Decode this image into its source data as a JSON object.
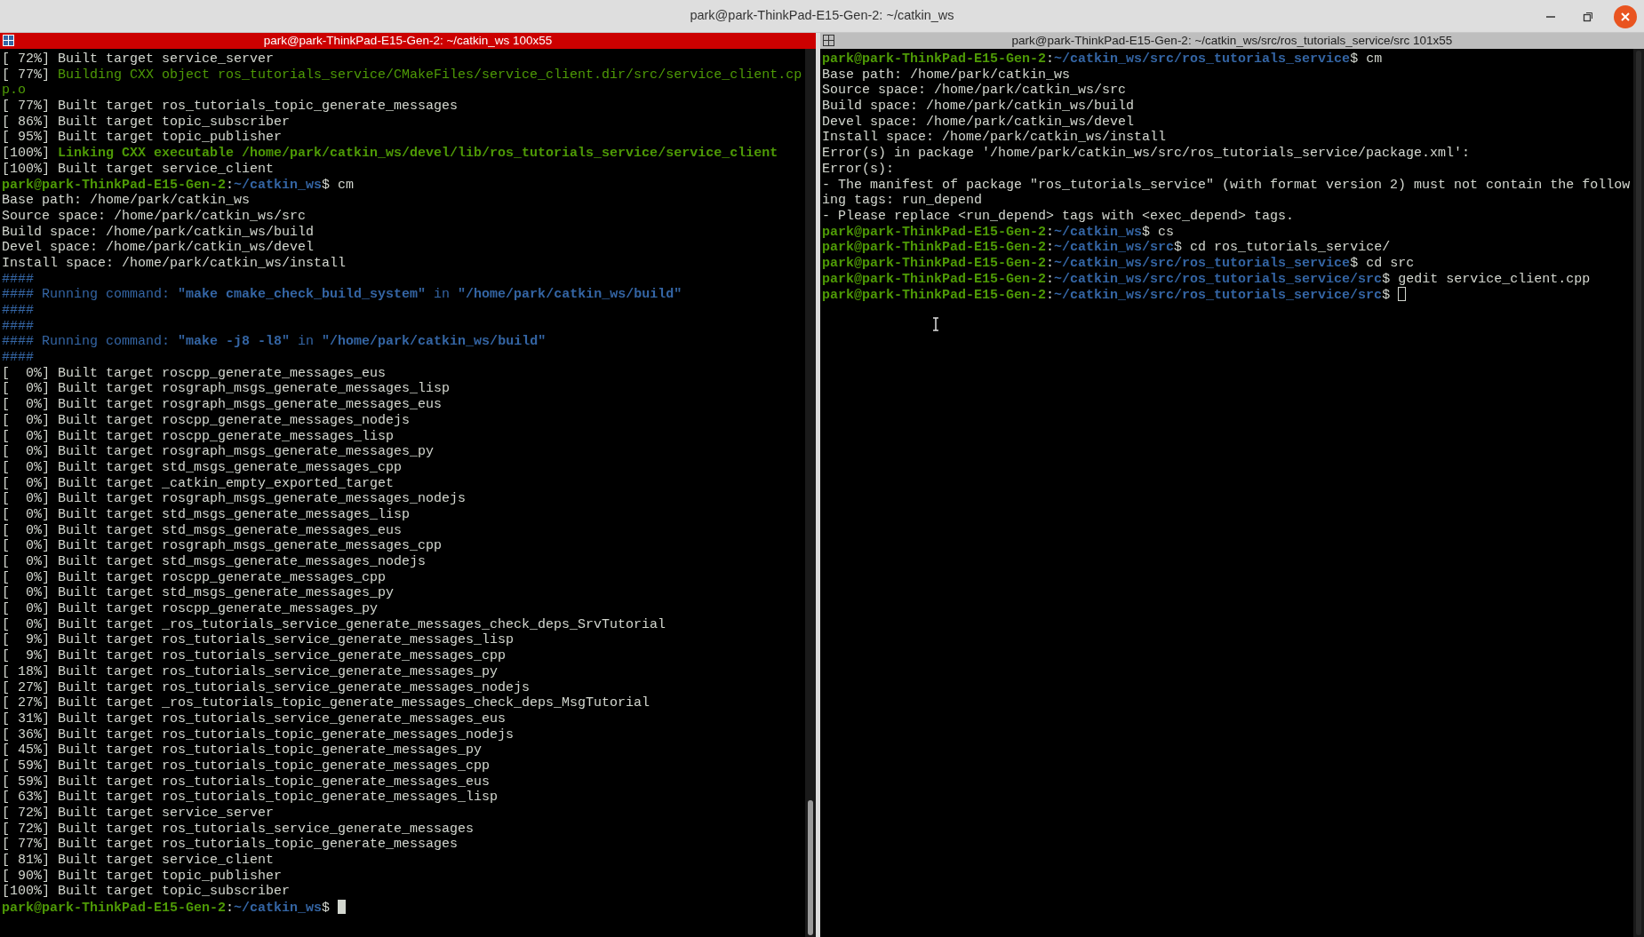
{
  "window": {
    "title": "park@park-ThinkPad-E15-Gen-2: ~/catkin_ws"
  },
  "panes": [
    {
      "title": "park@park-ThinkPad-E15-Gen-2: ~/catkin_ws 100x55",
      "focused": true,
      "lines": [
        [
          {
            "kind": "plain",
            "text": "[ 72%] Built target service_server"
          }
        ],
        [
          {
            "kind": "plain",
            "text": "[ 77%] "
          },
          {
            "kind": "green",
            "text": "Building CXX object ros_tutorials_service/CMakeFiles/service_client.dir/src/service_client.cp"
          }
        ],
        [
          {
            "kind": "green",
            "text": "p.o"
          }
        ],
        [
          {
            "kind": "plain",
            "text": "[ 77%] Built target ros_tutorials_topic_generate_messages"
          }
        ],
        [
          {
            "kind": "plain",
            "text": "[ 86%] Built target topic_subscriber"
          }
        ],
        [
          {
            "kind": "plain",
            "text": "[ 95%] Built target topic_publisher"
          }
        ],
        [
          {
            "kind": "plain",
            "text": "[100%] "
          },
          {
            "kind": "green-bold",
            "text": "Linking CXX executable /home/park/catkin_ws/devel/lib/ros_tutorials_service/service_client"
          }
        ],
        [
          {
            "kind": "plain",
            "text": "[100%] Built target service_client"
          }
        ],
        [
          {
            "kind": "green-bold",
            "text": "park@park-ThinkPad-E15-Gen-2"
          },
          {
            "kind": "plain",
            "text": ":"
          },
          {
            "kind": "blue-bold",
            "text": "~/catkin_ws"
          },
          {
            "kind": "plain",
            "text": "$ cm"
          }
        ],
        [
          {
            "kind": "plain",
            "text": "Base path: /home/park/catkin_ws"
          }
        ],
        [
          {
            "kind": "plain",
            "text": "Source space: /home/park/catkin_ws/src"
          }
        ],
        [
          {
            "kind": "plain",
            "text": "Build space: /home/park/catkin_ws/build"
          }
        ],
        [
          {
            "kind": "plain",
            "text": "Devel space: /home/park/catkin_ws/devel"
          }
        ],
        [
          {
            "kind": "plain",
            "text": "Install space: /home/park/catkin_ws/install"
          }
        ],
        [
          {
            "kind": "blue",
            "text": "####"
          }
        ],
        [
          {
            "kind": "blue",
            "text": "#### Running command: "
          },
          {
            "kind": "blue-bold",
            "text": "\"make cmake_check_build_system\""
          },
          {
            "kind": "blue",
            "text": " in "
          },
          {
            "kind": "blue-bold",
            "text": "\"/home/park/catkin_ws/build\""
          }
        ],
        [
          {
            "kind": "blue",
            "text": "####"
          }
        ],
        [
          {
            "kind": "blue",
            "text": "####"
          }
        ],
        [
          {
            "kind": "blue",
            "text": "#### Running command: "
          },
          {
            "kind": "blue-bold",
            "text": "\"make -j8 -l8\""
          },
          {
            "kind": "blue",
            "text": " in "
          },
          {
            "kind": "blue-bold",
            "text": "\"/home/park/catkin_ws/build\""
          }
        ],
        [
          {
            "kind": "blue",
            "text": "####"
          }
        ],
        [
          {
            "kind": "plain",
            "text": "[  0%] Built target roscpp_generate_messages_eus"
          }
        ],
        [
          {
            "kind": "plain",
            "text": "[  0%] Built target rosgraph_msgs_generate_messages_lisp"
          }
        ],
        [
          {
            "kind": "plain",
            "text": "[  0%] Built target rosgraph_msgs_generate_messages_eus"
          }
        ],
        [
          {
            "kind": "plain",
            "text": "[  0%] Built target roscpp_generate_messages_nodejs"
          }
        ],
        [
          {
            "kind": "plain",
            "text": "[  0%] Built target roscpp_generate_messages_lisp"
          }
        ],
        [
          {
            "kind": "plain",
            "text": "[  0%] Built target rosgraph_msgs_generate_messages_py"
          }
        ],
        [
          {
            "kind": "plain",
            "text": "[  0%] Built target std_msgs_generate_messages_cpp"
          }
        ],
        [
          {
            "kind": "plain",
            "text": "[  0%] Built target _catkin_empty_exported_target"
          }
        ],
        [
          {
            "kind": "plain",
            "text": "[  0%] Built target rosgraph_msgs_generate_messages_nodejs"
          }
        ],
        [
          {
            "kind": "plain",
            "text": "[  0%] Built target std_msgs_generate_messages_lisp"
          }
        ],
        [
          {
            "kind": "plain",
            "text": "[  0%] Built target std_msgs_generate_messages_eus"
          }
        ],
        [
          {
            "kind": "plain",
            "text": "[  0%] Built target rosgraph_msgs_generate_messages_cpp"
          }
        ],
        [
          {
            "kind": "plain",
            "text": "[  0%] Built target std_msgs_generate_messages_nodejs"
          }
        ],
        [
          {
            "kind": "plain",
            "text": "[  0%] Built target roscpp_generate_messages_cpp"
          }
        ],
        [
          {
            "kind": "plain",
            "text": "[  0%] Built target std_msgs_generate_messages_py"
          }
        ],
        [
          {
            "kind": "plain",
            "text": "[  0%] Built target roscpp_generate_messages_py"
          }
        ],
        [
          {
            "kind": "plain",
            "text": "[  0%] Built target _ros_tutorials_service_generate_messages_check_deps_SrvTutorial"
          }
        ],
        [
          {
            "kind": "plain",
            "text": "[  9%] Built target ros_tutorials_service_generate_messages_lisp"
          }
        ],
        [
          {
            "kind": "plain",
            "text": "[  9%] Built target ros_tutorials_service_generate_messages_cpp"
          }
        ],
        [
          {
            "kind": "plain",
            "text": "[ 18%] Built target ros_tutorials_service_generate_messages_py"
          }
        ],
        [
          {
            "kind": "plain",
            "text": "[ 27%] Built target ros_tutorials_service_generate_messages_nodejs"
          }
        ],
        [
          {
            "kind": "plain",
            "text": "[ 27%] Built target _ros_tutorials_topic_generate_messages_check_deps_MsgTutorial"
          }
        ],
        [
          {
            "kind": "plain",
            "text": "[ 31%] Built target ros_tutorials_service_generate_messages_eus"
          }
        ],
        [
          {
            "kind": "plain",
            "text": "[ 36%] Built target ros_tutorials_topic_generate_messages_nodejs"
          }
        ],
        [
          {
            "kind": "plain",
            "text": "[ 45%] Built target ros_tutorials_topic_generate_messages_py"
          }
        ],
        [
          {
            "kind": "plain",
            "text": "[ 59%] Built target ros_tutorials_topic_generate_messages_cpp"
          }
        ],
        [
          {
            "kind": "plain",
            "text": "[ 59%] Built target ros_tutorials_topic_generate_messages_eus"
          }
        ],
        [
          {
            "kind": "plain",
            "text": "[ 63%] Built target ros_tutorials_topic_generate_messages_lisp"
          }
        ],
        [
          {
            "kind": "plain",
            "text": "[ 72%] Built target service_server"
          }
        ],
        [
          {
            "kind": "plain",
            "text": "[ 72%] Built target ros_tutorials_service_generate_messages"
          }
        ],
        [
          {
            "kind": "plain",
            "text": "[ 77%] Built target ros_tutorials_topic_generate_messages"
          }
        ],
        [
          {
            "kind": "plain",
            "text": "[ 81%] Built target service_client"
          }
        ],
        [
          {
            "kind": "plain",
            "text": "[ 90%] Built target topic_publisher"
          }
        ],
        [
          {
            "kind": "plain",
            "text": "[100%] Built target topic_subscriber"
          }
        ],
        [
          {
            "kind": "green-bold",
            "text": "park@park-ThinkPad-E15-Gen-2"
          },
          {
            "kind": "plain",
            "text": ":"
          },
          {
            "kind": "blue-bold",
            "text": "~/catkin_ws"
          },
          {
            "kind": "plain",
            "text": "$ "
          }
        ]
      ]
    },
    {
      "title": "park@park-ThinkPad-E15-Gen-2: ~/catkin_ws/src/ros_tutorials_service/src 101x55",
      "focused": false,
      "lines": [
        [
          {
            "kind": "green-bold",
            "text": "park@park-ThinkPad-E15-Gen-2"
          },
          {
            "kind": "plain",
            "text": ":"
          },
          {
            "kind": "blue-bold",
            "text": "~/catkin_ws/src/ros_tutorials_service"
          },
          {
            "kind": "plain",
            "text": "$ cm"
          }
        ],
        [
          {
            "kind": "plain",
            "text": "Base path: /home/park/catkin_ws"
          }
        ],
        [
          {
            "kind": "plain",
            "text": "Source space: /home/park/catkin_ws/src"
          }
        ],
        [
          {
            "kind": "plain",
            "text": "Build space: /home/park/catkin_ws/build"
          }
        ],
        [
          {
            "kind": "plain",
            "text": "Devel space: /home/park/catkin_ws/devel"
          }
        ],
        [
          {
            "kind": "plain",
            "text": "Install space: /home/park/catkin_ws/install"
          }
        ],
        [
          {
            "kind": "plain",
            "text": "Error(s) in package '/home/park/catkin_ws/src/ros_tutorials_service/package.xml':"
          }
        ],
        [
          {
            "kind": "plain",
            "text": "Error(s):"
          }
        ],
        [
          {
            "kind": "plain",
            "text": "- The manifest of package \"ros_tutorials_service\" (with format version 2) must not contain the follow"
          }
        ],
        [
          {
            "kind": "plain",
            "text": "ing tags: run_depend"
          }
        ],
        [
          {
            "kind": "plain",
            "text": "- Please replace <run_depend> tags with <exec_depend> tags."
          }
        ],
        [
          {
            "kind": "green-bold",
            "text": "park@park-ThinkPad-E15-Gen-2"
          },
          {
            "kind": "plain",
            "text": ":"
          },
          {
            "kind": "blue-bold",
            "text": "~/catkin_ws"
          },
          {
            "kind": "plain",
            "text": "$ cs"
          }
        ],
        [
          {
            "kind": "green-bold",
            "text": "park@park-ThinkPad-E15-Gen-2"
          },
          {
            "kind": "plain",
            "text": ":"
          },
          {
            "kind": "blue-bold",
            "text": "~/catkin_ws/src"
          },
          {
            "kind": "plain",
            "text": "$ cd ros_tutorials_service/"
          }
        ],
        [
          {
            "kind": "green-bold",
            "text": "park@park-ThinkPad-E15-Gen-2"
          },
          {
            "kind": "plain",
            "text": ":"
          },
          {
            "kind": "blue-bold",
            "text": "~/catkin_ws/src/ros_tutorials_service"
          },
          {
            "kind": "plain",
            "text": "$ cd src"
          }
        ],
        [
          {
            "kind": "green-bold",
            "text": "park@park-ThinkPad-E15-Gen-2"
          },
          {
            "kind": "plain",
            "text": ":"
          },
          {
            "kind": "blue-bold",
            "text": "~/catkin_ws/src/ros_tutorials_service/src"
          },
          {
            "kind": "plain",
            "text": "$ gedit service_client.cpp"
          }
        ],
        [
          {
            "kind": "green-bold",
            "text": "park@park-ThinkPad-E15-Gen-2"
          },
          {
            "kind": "plain",
            "text": ":"
          },
          {
            "kind": "blue-bold",
            "text": "~/catkin_ws/src/ros_tutorials_service/src"
          },
          {
            "kind": "plain",
            "text": "$ "
          }
        ]
      ]
    }
  ]
}
